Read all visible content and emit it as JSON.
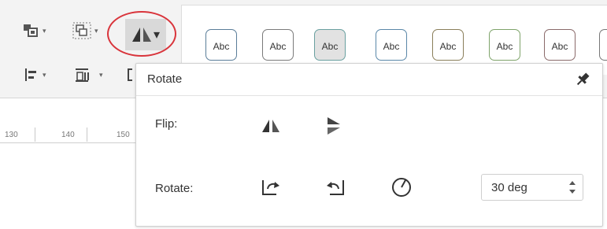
{
  "ribbon": {
    "tools_row1": [
      "arrange-icon",
      "group-icon",
      "flip-icon"
    ],
    "tools_row2": [
      "align-icon",
      "distribute-icon",
      "size-icon"
    ],
    "highlight_color": "#d9343b"
  },
  "styles_gallery": {
    "swatches": [
      {
        "label": "Abc",
        "border_color": "#5a7d99"
      },
      {
        "label": "Abc",
        "border_color": "#7a7a7a"
      },
      {
        "label": "Abc",
        "border_color": "#6aa0a0"
      },
      {
        "label": "Abc",
        "border_color": "#5a87a8"
      },
      {
        "label": "Abc",
        "border_color": "#8a7e5a"
      },
      {
        "label": "Abc",
        "border_color": "#7ea36a"
      },
      {
        "label": "Abc",
        "border_color": "#8a6a6a"
      }
    ]
  },
  "ruler": {
    "ticks": [
      "130",
      "140",
      "150"
    ]
  },
  "rotate_panel": {
    "title": "Rotate",
    "flip_label": "Flip:",
    "rotate_label": "Rotate:",
    "degree_value": "30 deg"
  }
}
